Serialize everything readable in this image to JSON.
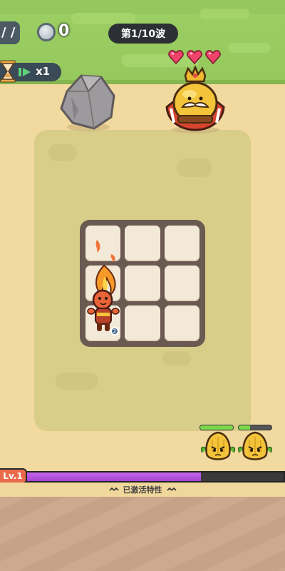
{
  "hud": {
    "left_chip_text": "/ /",
    "coins": "0",
    "wave": "第1/10波",
    "speed": "x1"
  },
  "hearts": {
    "count": 3,
    "color": "#f0436a"
  },
  "board": {
    "rows": 3,
    "cols": 3,
    "hero_slot": "left column, rows 1-3"
  },
  "hero": {
    "badge": "2"
  },
  "enemies": [
    {
      "name": "sprout-enemy-1",
      "hp": 1.0
    },
    {
      "name": "sprout-enemy-2",
      "hp": 0.35
    }
  ],
  "player": {
    "level": "Lv.1",
    "xp_progress": 0.68
  },
  "traits": {
    "label": "已激活特性"
  },
  "colors": {
    "grass": "#9ccf63",
    "sand": "#f2d99f",
    "board": "#6a5a52",
    "xp": "#b552dc",
    "level_chip": "#e96b4c"
  }
}
